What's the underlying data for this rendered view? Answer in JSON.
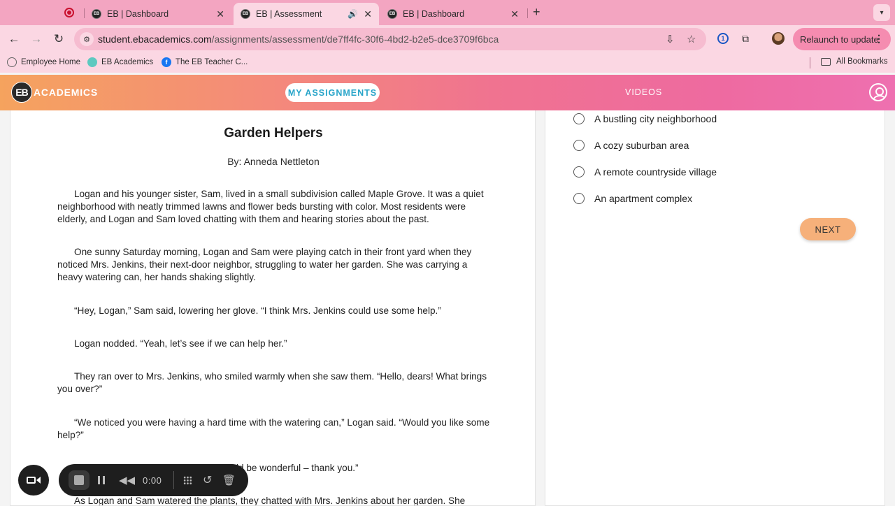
{
  "browser": {
    "tabs": [
      {
        "title": "EB | Dashboard",
        "active": false
      },
      {
        "title": "EB | Assessment",
        "active": true
      },
      {
        "title": "EB | Dashboard",
        "active": false
      }
    ],
    "url_host": "student.ebacademics.com",
    "url_path": "/assignments/assessment/de7ff4fc-30f6-4bd2-b2e5-dce3709f6bca",
    "relaunch_label": "Relaunch to update",
    "bookmarks": [
      {
        "label": "Employee Home"
      },
      {
        "label": "EB Academics"
      },
      {
        "label": "The EB Teacher C..."
      }
    ],
    "all_bookmarks_label": "All Bookmarks"
  },
  "app": {
    "logo_initials": "EB",
    "logo_word": "ACADEMICS",
    "nav": {
      "assignments": "MY ASSIGNMENTS",
      "videos": "VIDEOS"
    }
  },
  "passage": {
    "title": "Garden Helpers",
    "byline": "By: Anneda Nettleton",
    "paragraphs": [
      "Logan and his younger sister, Sam, lived in a small subdivision called Maple Grove. It was a quiet neighborhood with neatly trimmed lawns and flower beds bursting with color. Most residents were elderly, and Logan and Sam loved chatting with them and hearing stories about the past.",
      "One sunny Saturday morning, Logan and Sam were playing catch in their front yard when they noticed Mrs. Jenkins, their next-door neighbor, struggling to water her garden. She was carrying a heavy watering can, her hands shaking slightly.",
      "“Hey, Logan,” Sam said, lowering her glove. “I think Mrs. Jenkins could use some help.”",
      "Logan nodded. “Yeah, let’s see if we can help her.”",
      "They ran over to Mrs. Jenkins, who smiled warmly when she saw them. “Hello, dears! What brings you over?”",
      " “We noticed you were having a hard time with the watering can,” Logan said. “Would you like some help?”",
      "ld be wonderful – thank you.”",
      "As Logan and Sam watered the plants, they chatted with Mrs. Jenkins about her garden. She"
    ]
  },
  "question": {
    "options": [
      "A bustling city neighborhood",
      "A cozy suburban area",
      "A remote countryside village",
      "An apartment complex"
    ],
    "next_label": "NEXT"
  },
  "recorder": {
    "timer": "0:00"
  }
}
